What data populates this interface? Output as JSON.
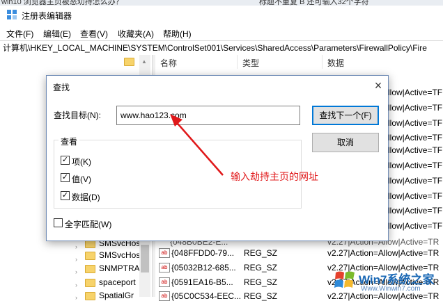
{
  "top_strip": {
    "left": "win10 浏览器主页被恶劝持怎么办？",
    "right": "标题不重复 B 还可输入32个字符"
  },
  "window": {
    "title": "注册表编辑器"
  },
  "menu": [
    "文件(F)",
    "编辑(E)",
    "查看(V)",
    "收藏夹(A)",
    "帮助(H)"
  ],
  "address": "计算机\\HKEY_LOCAL_MACHINE\\SYSTEM\\ControlSet001\\Services\\SharedAccess\\Parameters\\FirewallPolicy\\Fire",
  "columns": [
    "名称",
    "类型",
    "数据"
  ],
  "tree": [
    "SMSvcHos",
    "SMSvcHos",
    "SNMPTRA",
    "spaceport",
    "SpatialGr"
  ],
  "rows": [
    {
      "name": "{048FFDD0-79...",
      "type": "REG_SZ",
      "data": "v2.27|Action=Allow|Active=TR"
    },
    {
      "name": "{05032B12-685...",
      "type": "REG_SZ",
      "data": "v2.27|Action=Allow|Active=TR"
    },
    {
      "name": "{0591EA16-B5...",
      "type": "REG_SZ",
      "data": "v2.27|Action=Allow|Active=TR"
    },
    {
      "name": "{05C0C534-EEC...",
      "type": "REG_SZ",
      "data": "v2.27|Action=Allow|Active=TR"
    }
  ],
  "partial_row": {
    "name": "{048B0BE2-E...",
    "data": "v2.27|Action=Allow|Active=TR"
  },
  "right_clip": [
    "llow|Active=TF",
    "llow|Active=TF",
    "llow|Active=TF",
    "llow|Active=TF",
    "llow|Active=TF",
    "llow|Active=TF",
    "llow|Active=TF",
    "llow|Active=TF",
    "llow|Active=TF",
    "llow|Active=TF"
  ],
  "dialog": {
    "title": "查找",
    "find_label": "查找目标(N):",
    "find_value": "www.hao123.com",
    "find_next": "查找下一个(F)",
    "cancel": "取消",
    "group_title": "查看",
    "options": [
      {
        "label": "项(K)",
        "checked": true
      },
      {
        "label": "值(V)",
        "checked": true
      },
      {
        "label": "数据(D)",
        "checked": true
      }
    ],
    "whole_match": {
      "label": "全字匹配(W)",
      "checked": false
    }
  },
  "annotation": "输入劫持主页的网址",
  "watermark": {
    "brand": "Win7系统之家",
    "url": "Www.Winwin7.com"
  },
  "colors": {
    "accent": "#0078d7",
    "annotation": "#e0181a",
    "folder": "#f7d36b"
  }
}
